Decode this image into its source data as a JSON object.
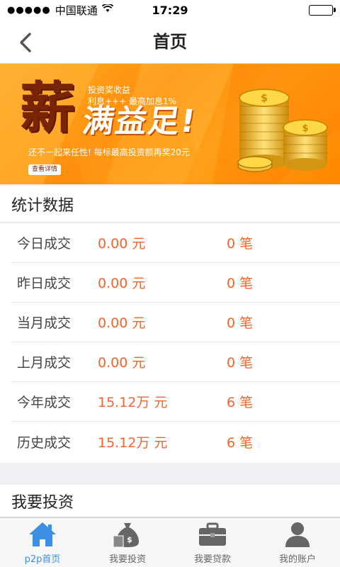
{
  "status_bar": {
    "signal": "●●●●●",
    "carrier": "中国联通",
    "time": "17:29"
  },
  "nav": {
    "title": "首页"
  },
  "banner": {
    "big_char": "薪",
    "slogan": "满益足!",
    "line1": "投资奖收益",
    "line2": "利息+++   最高加息1%",
    "line3": "还不一起来任性!   每标最高投资额再奖20元",
    "detail_button": "查看详情"
  },
  "stats": {
    "title": "统计数据",
    "rows": [
      {
        "label": "今日成交",
        "amount": "0.00 元",
        "count": "0 笔"
      },
      {
        "label": "昨日成交",
        "amount": "0.00 元",
        "count": "0 笔"
      },
      {
        "label": "当月成交",
        "amount": "0.00 元",
        "count": "0 笔"
      },
      {
        "label": "上月成交",
        "amount": "0.00 元",
        "count": "0 笔"
      },
      {
        "label": "今年成交",
        "amount": "15.12万 元",
        "count": "6 笔"
      },
      {
        "label": "历史成交",
        "amount": "15.12万 元",
        "count": "6 笔"
      }
    ]
  },
  "invest": {
    "title": "我要投资"
  },
  "tabbar": {
    "active_color": "#3b8fe4",
    "inactive_color": "#666666",
    "tabs": [
      {
        "label": "p2p首页",
        "icon": "home-icon"
      },
      {
        "label": "我要投资",
        "icon": "money-bag-icon"
      },
      {
        "label": "我要贷款",
        "icon": "briefcase-icon"
      },
      {
        "label": "我的账户",
        "icon": "user-icon"
      }
    ]
  },
  "colors": {
    "accent": "#f0662a",
    "banner_orange": "#ff9a12"
  }
}
